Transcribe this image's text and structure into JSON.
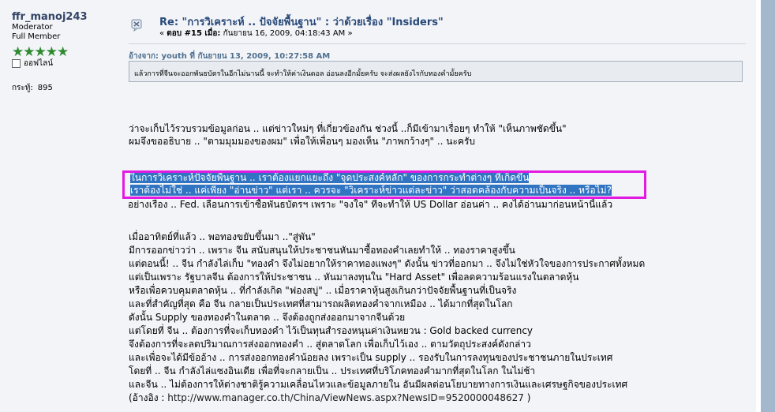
{
  "user": {
    "name": "ffr_manoj243",
    "role1": "Moderator",
    "role2": "Full Member",
    "stars": "★★★★★",
    "online_status": "ออฟไลน์",
    "karma_label": "กระทู้:",
    "karma_value": "895"
  },
  "post": {
    "title": "Re: \"การวิเคราะห์ .. ปัจจัยพื้นฐาน\" : ว่าด้วยเรื่อง \"Insiders\"",
    "subtitle_prefix": "« ",
    "reply_label": "ตอบ #15 เมื่อ:",
    "date": " กันยายน 16, 2009, 04:18:43 AM »"
  },
  "quote": {
    "header": "อ้างจาก: youth ที่ กันยายน 13, 2009, 10:27:58 AM",
    "text": "แล้วการที่จีนจะออกพันธบัตรในอีกไม่นานนี้ จะทำให้ค่าเงินดอล อ่อนลงอีกมั้ยครับ จะส่งผลยังไรกับทองคำมั้ยครับ"
  },
  "body": {
    "p1": [
      "ว่าจะเก็บไว้รวบรวมข้อมูลก่อน .. แต่ข่าวใหม่ๆ ที่เกี่ยวข้องกัน ช่วงนี้ ..ก็มีเข้ามาเรื่อยๆ ทำให้ \"เห็นภาพชัดขึ้น\"",
      "ผมจึงขออธิบาย ..  \"ตามมุมมองของผม\"   เพื่อให้เพื่อนๆ มองเห็น \"ภาพกว้างๆ\"  .. นะครับ"
    ],
    "hl1": "ในการวิเคราะห์ปัจจัยพื้นฐาน .. เราต้องแยกแยะถึง \"จุดประสงค์หลัก\" ของการกระทำต่างๆ ที่เกิดขึ้น",
    "hl2": "เราต้องไม่ใช่ .. แค่เพียง \"อ่านข่าว\"   แต่เรา ..  ควรจะ \"วิเคราะห์ข่าวแต่ละข่าว\" ว่าสอดคล้องกับความเป็นจริง .. หรือไม่?",
    "p2_line": "อย่างเรื่อง  .. Fed. เลื่อนการเข้าซื้อพันธบัตรฯ  เพราะ \"จงใจ\" ที่จะทำให้ US Dollar อ่อนค่า .. คงได้อ่านมาก่อนหน้านี้แล้ว",
    "p3": [
      "เมื่ออาทิตย์ที่แล้ว .. พอทองขยับขึ้นมา ..\"สู่พัน\"",
      "มีการออกข่าวว่า .. เพราะ จีน สนับสนุนให้ประชาชนหันมาซื้อทองคำเลยทำให้ .. ทองราคาสูงขึ้น",
      "แต่ตอนนี้! .. จีน กำลังไล่เก็บ  \"ทองคำ จึงไม่อยากให้ราคาทองแพงๆ\"    ดังนั้น ข่าวที่ออกมา .. จึงไม่ใช่หัวใจของการประกาศทั้งหมด",
      "แต่เป็นเพราะ รัฐบาลจีน ต้องการให้ประชาชน .. หันมาลงทุนใน \"Hard Asset\" เพื่อลดความร้อนแรงในตลาดหุ้น",
      "หรือเพื่อควบคุมตลาดหุ้น .. ที่กำลังเกิด \"ฟองสบู่\"  .. เมื่อราคาหุ้นสูงเกินกว่าปัจจัยพื้นฐานที่เป็นจริง",
      "และที่สำคัญที่สุด คือ  จีน กลายเป็นประเทศที่สามารถผลิตทองคำจากเหมือง .. ได้มากที่สุดในโลก",
      "ดังนั้น Supply ของทองคำในตลาด .. จึงต้องถูกส่งออกมาจากจีนด้วย",
      "แต่โดยที่ จีน .. ต้องการที่จะเก็บทองคำ ไว้เป็นทุนสำรองหนุนค่าเงินหยวน : Gold backed currency",
      "จึงต้องการที่จะลดปริมาณการส่งออกทองคำ .. สู่ตลาดโลก เพื่อเก็บไว้เอง .. ตามวัตถุประสงค์ดังกล่าว",
      "และเพื่อจะได้มีข้ออ้าง .. การส่งออกทองคำน้อยลง   เพราะเป็น supply .. รองรับในการลงทุนของประชาชนภายในประเทศ",
      "โดยที่ .. จีน กำลังไล่แซงอินเดีย  เพื่อที่จะกลายเป็น .. ประเทศที่บริโภคทองคำมากที่สุดในโลก ในไม่ช้า",
      "และจีน .. ไม่ต้องการให้ต่างชาติรู้ความเคลื่อนไหวและข้อมูลภายใน    อันมีผลต่อนโยบายทางการเงินและเศรษฐกิจของประเทศ"
    ],
    "ref_prefix": "(อ้างอิง : ",
    "ref_url": "http://www.manager.co.th/China/ViewNews.aspx?NewsID=9520000048627",
    "ref_suffix": " )"
  },
  "colors": {
    "highlight": "#3175c2",
    "annotation_border": "#e21ae2",
    "star": "#2f8a2f",
    "title": "#2a4a7a"
  },
  "icons": {
    "topic": "xx-topic-icon",
    "checkbox": "offline-checkbox"
  }
}
